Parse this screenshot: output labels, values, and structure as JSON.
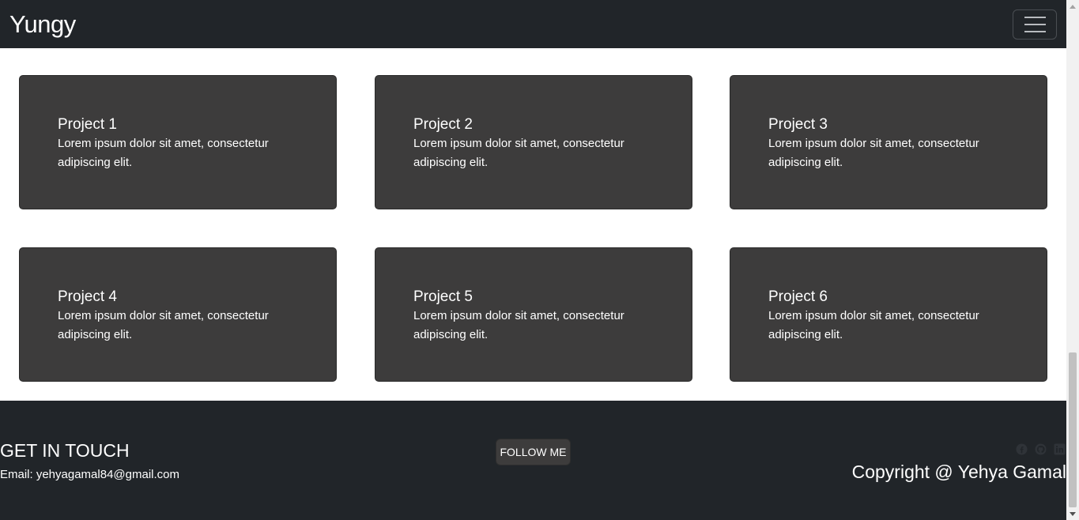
{
  "navbar": {
    "brand": "Yungy",
    "toggle_icon": "hamburger-icon"
  },
  "projects": [
    {
      "title": "Project 1",
      "text": "Lorem ipsum dolor sit amet, consectetur adipiscing elit."
    },
    {
      "title": "Project 2",
      "text": "Lorem ipsum dolor sit amet, consectetur adipiscing elit."
    },
    {
      "title": "Project 3",
      "text": "Lorem ipsum dolor sit amet, consectetur adipiscing elit."
    },
    {
      "title": "Project 4",
      "text": "Lorem ipsum dolor sit amet, consectetur adipiscing elit."
    },
    {
      "title": "Project 5",
      "text": "Lorem ipsum dolor sit amet, consectetur adipiscing elit."
    },
    {
      "title": "Project 6",
      "text": "Lorem ipsum dolor sit amet, consectetur adipiscing elit."
    }
  ],
  "footer": {
    "contact_title": "GET IN TOUCH",
    "email": "Email: yehyagamal84@gmail.com",
    "follow_label": "FOLLOW ME",
    "social_icons": [
      "facebook-icon",
      "github-icon",
      "linkedin-icon"
    ],
    "copyright": "Copyright @ Yehya Gamal"
  },
  "colors": {
    "navbar_bg": "#212529",
    "card_bg": "#3d3c3c",
    "footer_bg": "#212529",
    "text": "#ffffff"
  }
}
